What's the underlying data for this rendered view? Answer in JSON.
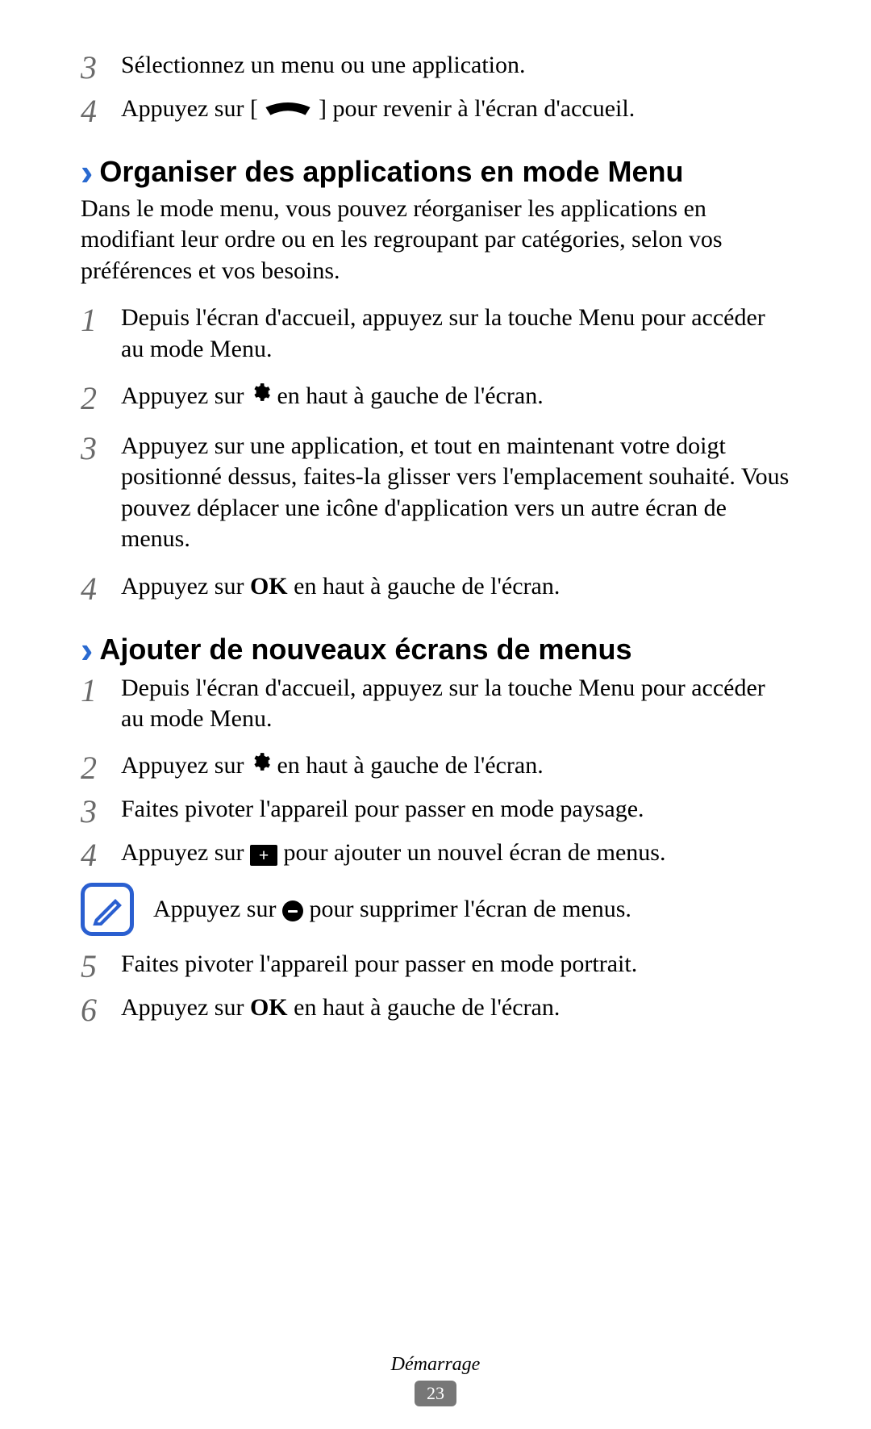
{
  "intro": {
    "step3": {
      "num": "3",
      "text": "Sélectionnez un menu ou une application."
    },
    "step4": {
      "num": "4",
      "text_a": "Appuyez sur [",
      "text_b": "] pour revenir à l'écran d'accueil."
    }
  },
  "section1": {
    "chevron": "›",
    "title": "Organiser des applications en mode Menu",
    "para": "Dans le mode menu, vous pouvez réorganiser les applications en modifiant leur ordre ou en les regroupant par catégories, selon vos préférences et vos besoins.",
    "step1": {
      "num": "1",
      "text": "Depuis l'écran d'accueil, appuyez sur la touche Menu pour accéder au mode Menu."
    },
    "step2": {
      "num": "2",
      "text_a": "Appuyez sur ",
      "text_b": " en haut à gauche de l'écran."
    },
    "step3": {
      "num": "3",
      "line1": "Appuyez sur une application, et tout en maintenant votre doigt positionné dessus, faites-la glisser vers l'emplacement souhaité. ",
      "line2": "Vous pouvez déplacer une icône d'application vers un autre écran de menus."
    },
    "step4": {
      "num": "4",
      "text_a": "Appuyez sur ",
      "bold": "OK",
      "text_b": " en haut à gauche de l'écran."
    }
  },
  "section2": {
    "chevron": "›",
    "title": "Ajouter de nouveaux écrans de menus",
    "step1": {
      "num": "1",
      "text": "Depuis l'écran d'accueil, appuyez sur la touche Menu pour accéder au mode Menu."
    },
    "step2": {
      "num": "2",
      "text_a": "Appuyez sur ",
      "text_b": " en haut à gauche de l'écran."
    },
    "step3": {
      "num": "3",
      "text": "Faites pivoter l'appareil pour passer en mode paysage."
    },
    "step4": {
      "num": "4",
      "text_a": "Appuyez sur ",
      "text_b": " pour ajouter un nouvel écran de menus."
    },
    "note": {
      "text_a": "Appuyez sur ",
      "text_b": " pour supprimer l'écran de menus."
    },
    "step5": {
      "num": "5",
      "text": "Faites pivoter l'appareil pour passer en mode portrait."
    },
    "step6": {
      "num": "6",
      "text_a": "Appuyez sur ",
      "bold": "OK",
      "text_b": " en haut à gauche de l'écran."
    }
  },
  "footer": {
    "section": "Démarrage",
    "page": "23"
  }
}
